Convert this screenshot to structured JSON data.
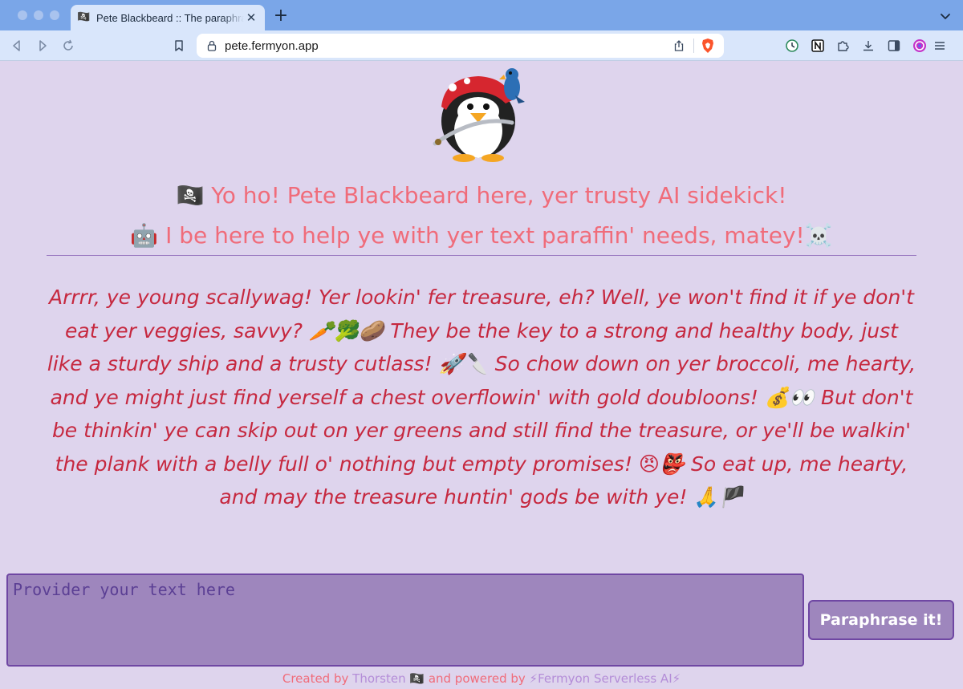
{
  "browser": {
    "tab": {
      "favicon": "🏴‍☠️",
      "title": "Pete Blackbeard :: The paraphraser"
    },
    "url": "pete.fermyon.app"
  },
  "header": {
    "greeting_line1": "🏴‍☠️ Yo ho! Pete Blackbeard here, yer trusty AI sidekick!",
    "greeting_line2": "🤖 I be here to help ye with yer text paraffin' needs, matey!☠️"
  },
  "response": {
    "text": "Arrrr, ye young scallywag! Yer lookin' fer treasure, eh? Well, ye won't find it if ye don't eat yer veggies, savvy? 🥕🥦🥔 They be the key to a strong and healthy body, just like a sturdy ship and a trusty cutlass! 🚀🔪 So chow down on yer broccoli, me hearty, and ye might just find yerself a chest overflowin' with gold doubloons! 💰👀 But don't be thinkin' ye can skip out on yer greens and still find the treasure, or ye'll be walkin' the plank with a belly full o' nothing but empty promises! 😠👺 So eat up, me hearty, and may the treasure huntin' gods be with ye! 🙏🏴"
  },
  "input": {
    "placeholder": "Provider your text here",
    "value": ""
  },
  "actions": {
    "paraphrase_label": "Paraphrase it!"
  },
  "footer": {
    "prefix": "Created by ",
    "author": "Thorsten",
    "middle": " 🏴‍☠️ and powered by ",
    "powered": "⚡Fermyon Serverless AI⚡"
  },
  "colors": {
    "background": "#ded4ed",
    "heading": "#f06c7a",
    "response_text": "#c6283f",
    "input_bg": "#9e86bd",
    "input_border": "#6f47a3",
    "link": "#b48dd8"
  }
}
